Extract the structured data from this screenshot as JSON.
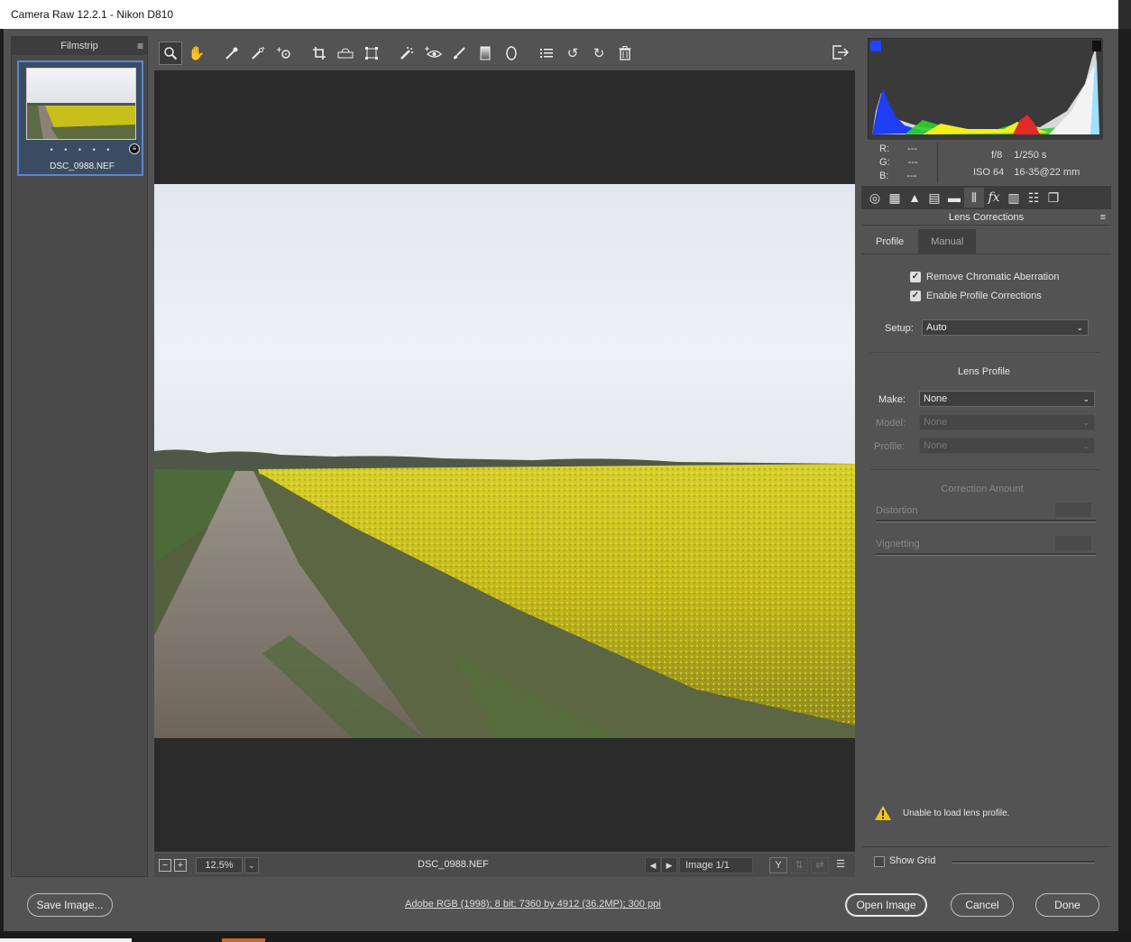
{
  "window": {
    "title": "Camera Raw 12.2.1  -  Nikon D810"
  },
  "filmstrip": {
    "header": "Filmstrip",
    "thumb": {
      "filename": "DSC_0988.NEF",
      "rating_dots": "• • • • •"
    }
  },
  "toolbar": {
    "tools": [
      "zoom-tool",
      "hand-tool",
      "white-balance-tool",
      "color-sampler-tool",
      "targeted-adjustment-tool",
      "crop-tool",
      "straighten-tool",
      "transform-tool",
      "spot-removal-tool",
      "red-eye-tool",
      "adjustment-brush-tool",
      "graduated-filter-tool",
      "radial-filter-tool",
      "preferences",
      "rotate-ccw",
      "rotate-cw",
      "trash"
    ]
  },
  "statusbar": {
    "zoom_minus": "−",
    "zoom_plus": "+",
    "zoom_value": "12.5%",
    "filename": "DSC_0988.NEF",
    "image_count": "Image 1/1",
    "compare_label": "Y"
  },
  "histogram": {
    "r_label": "R:",
    "g_label": "G:",
    "b_label": "B:",
    "r_value": "---",
    "g_value": "---",
    "b_value": "---",
    "aperture": "f/8",
    "shutter": "1/250 s",
    "iso": "ISO 64",
    "lens": "16-35@22 mm"
  },
  "panel": {
    "title": "Lens Corrections",
    "tabs": {
      "profile": "Profile",
      "manual": "Manual"
    },
    "remove_ca": "Remove Chromatic Aberration",
    "enable_profile": "Enable Profile Corrections",
    "setup_label": "Setup:",
    "setup_value": "Auto",
    "lens_profile_heading": "Lens Profile",
    "make_label": "Make:",
    "make_value": "None",
    "model_label": "Model:",
    "model_value": "None",
    "profile_label": "Profile:",
    "profile_value": "None",
    "correction_amount": "Correction Amount",
    "distortion_label": "Distortion",
    "vignetting_label": "Vignetting",
    "warning": "Unable to load lens profile.",
    "show_grid": "Show Grid"
  },
  "footer": {
    "save_image": "Save Image...",
    "image_info": "Adobe RGB (1998); 8 bit; 7360 by 4912 (36.2MP); 300 ppi",
    "open_image": "Open Image",
    "cancel": "Cancel",
    "done": "Done"
  }
}
